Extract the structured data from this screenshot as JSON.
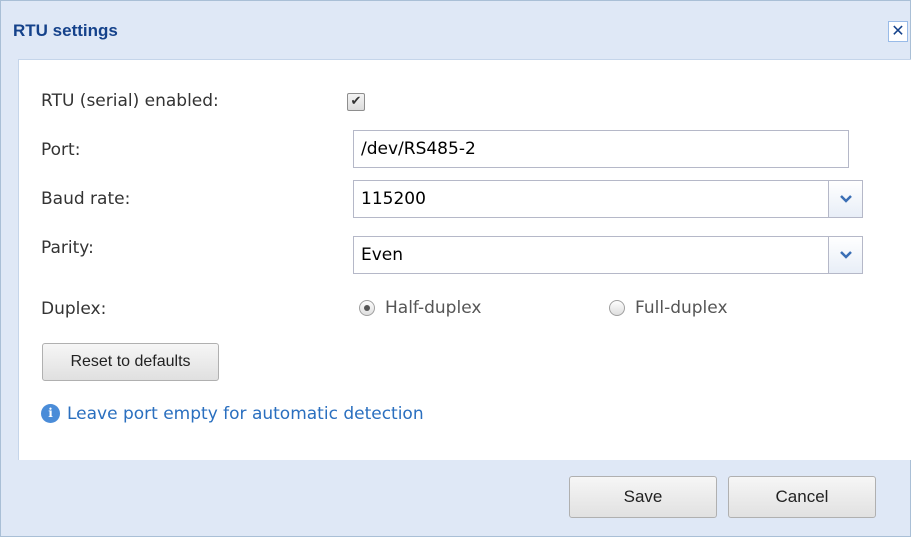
{
  "dialog": {
    "title": "RTU settings",
    "close_icon": "close-icon"
  },
  "form": {
    "enabled_label": "RTU (serial) enabled:",
    "enabled_checked": true,
    "port_label": "Port:",
    "port_value": "/dev/RS485-2",
    "baud_label": "Baud rate:",
    "baud_value": "115200",
    "parity_label": "Parity:",
    "parity_value": "Even",
    "duplex_label": "Duplex:",
    "duplex_options": [
      {
        "label": "Half-duplex",
        "checked": true
      },
      {
        "label": "Full-duplex",
        "checked": false
      }
    ],
    "reset_label": "Reset to defaults",
    "info_icon": "info-icon",
    "info_text": "Leave port empty for automatic detection"
  },
  "footer": {
    "save_label": "Save",
    "cancel_label": "Cancel"
  },
  "colors": {
    "title": "#15428b",
    "panel": "#dfe8f6",
    "info": "#2a6fbf"
  }
}
